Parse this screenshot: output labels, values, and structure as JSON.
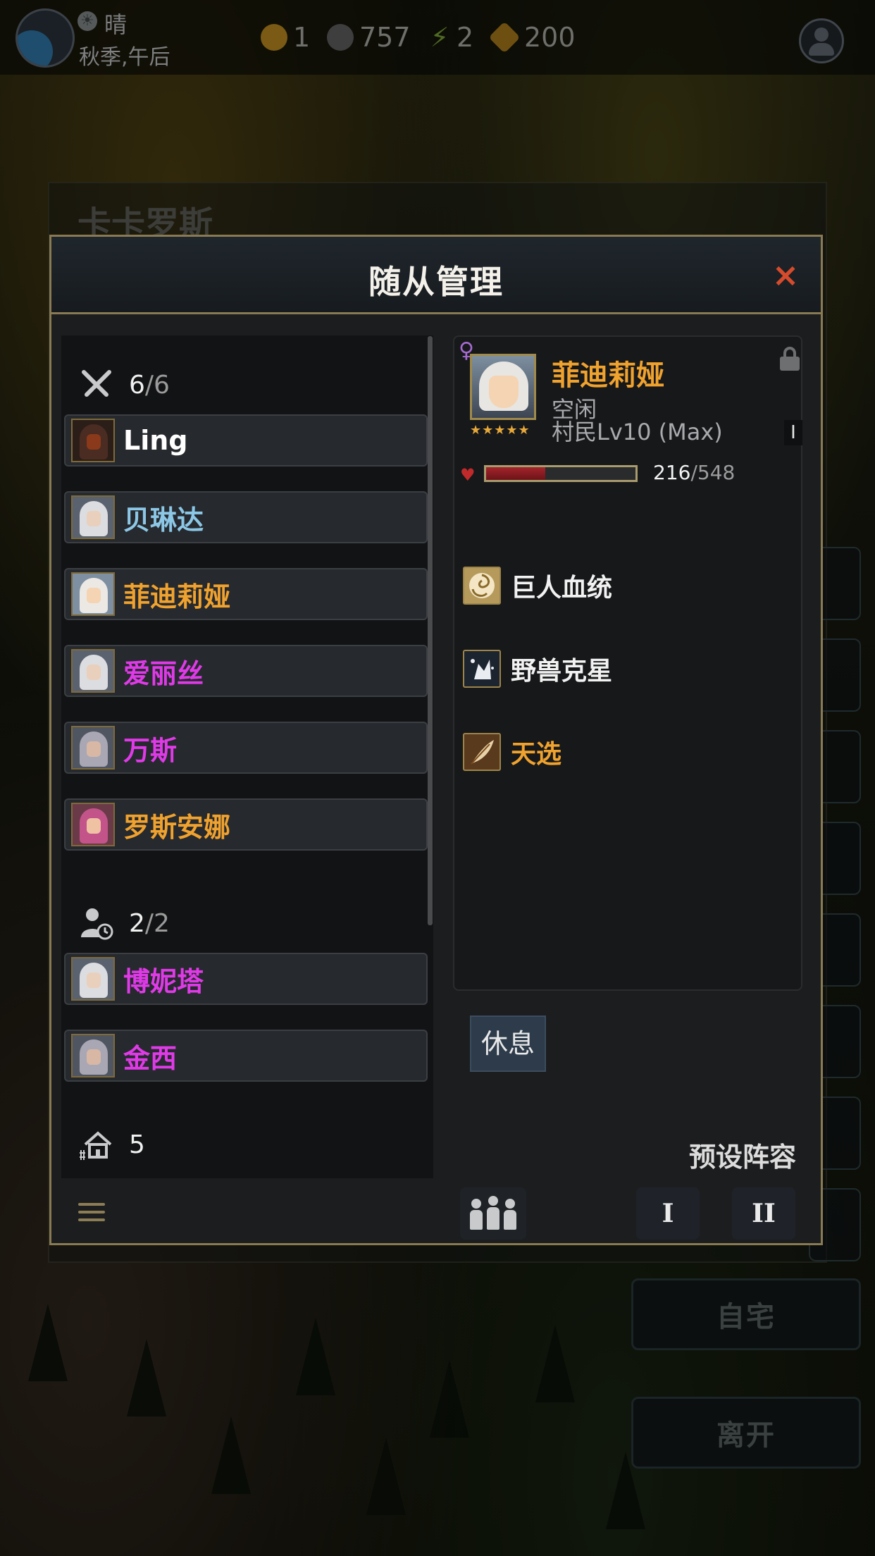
{
  "topbar": {
    "weather": "晴",
    "season": "秋季,午后",
    "resources": [
      {
        "icon": "gold-coin-icon",
        "value": "1"
      },
      {
        "icon": "silver-coin-icon",
        "value": "757"
      },
      {
        "icon": "energy-bolt-icon",
        "value": "2"
      },
      {
        "icon": "rune-stone-icon",
        "value": "200"
      }
    ]
  },
  "background": {
    "city_name": "卡卡罗斯",
    "home_button": "自宅",
    "leave_button": "离开"
  },
  "modal": {
    "title": "随从管理",
    "close_label": "×"
  },
  "groups": {
    "combat": {
      "current": "6",
      "max": "6"
    },
    "reserve": {
      "current": "2",
      "max": "2"
    },
    "housing": {
      "value": "5"
    }
  },
  "combat_followers": [
    {
      "name": "Ling",
      "color": "#ffffff"
    },
    {
      "name": "贝琳达",
      "color": "#8cc7e6"
    },
    {
      "name": "菲迪莉娅",
      "color": "#f0a22e"
    },
    {
      "name": "爱丽丝",
      "color": "#e03ae8"
    },
    {
      "name": "万斯",
      "color": "#e03ae8"
    },
    {
      "name": "罗斯安娜",
      "color": "#f0a22e"
    }
  ],
  "reserve_followers": [
    {
      "name": "博妮塔",
      "color": "#e03ae8"
    },
    {
      "name": "金西",
      "color": "#e03ae8"
    }
  ],
  "detail": {
    "name": "菲迪莉娅",
    "stars": "★★★★★",
    "status": "空闲",
    "class_level": "村民Lv10 (Max)",
    "tier_badge": "I",
    "hp_current": "216",
    "hp_max": "548",
    "hp_fraction": 0.394,
    "traits": [
      {
        "name": "巨人血统",
        "color": "#f2f2f2",
        "icon": "giant-bloodline-icon"
      },
      {
        "name": "野兽克星",
        "color": "#f2f2f2",
        "icon": "beast-bane-icon"
      },
      {
        "name": "天选",
        "color": "#f0a22e",
        "icon": "chosen-feather-icon"
      }
    ]
  },
  "actions": {
    "rest_button": "休息",
    "preset_label": "预设阵容",
    "preset_1": "I",
    "preset_2": "II"
  },
  "colors": {
    "modal_border": "#8a7a52",
    "accent_gold": "#f0a22e",
    "accent_magenta": "#e03ae8",
    "close_red": "#d64b2c"
  }
}
